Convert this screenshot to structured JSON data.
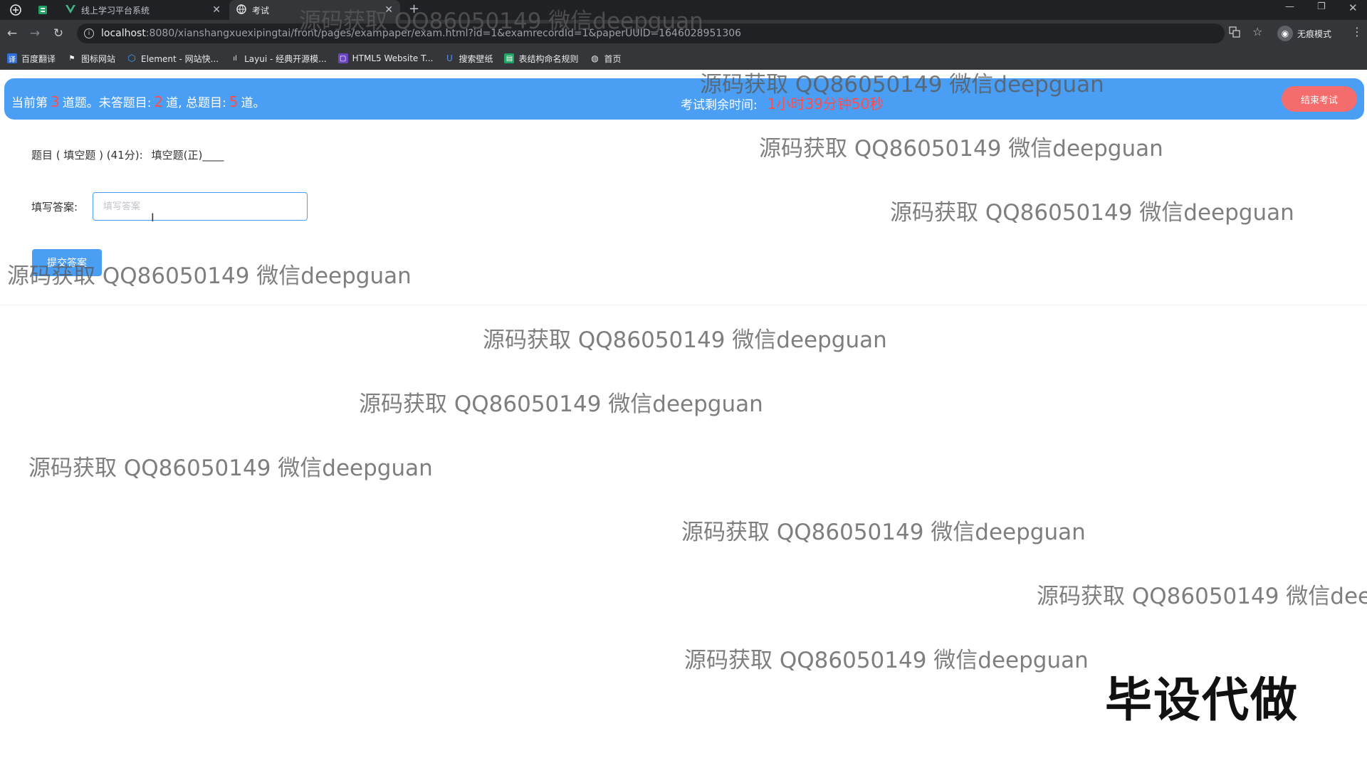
{
  "browser": {
    "tabs": [
      {
        "title": "线上学习平台系统"
      },
      {
        "title": "考试"
      }
    ],
    "url_host": "localhost",
    "url_path": ":8080/xianshangxuexipingtai/front/pages/exampaper/exam.html?id=1&examrecordId=1&paperUUID=1646028951306",
    "profile_label": "无痕模式",
    "bookmarks": [
      "百度翻译",
      "图标网站",
      "Element - 网站快...",
      "Layui - 经典开源模...",
      "HTML5 Website T...",
      "搜索壁纸",
      "表结构命名规则",
      "首页"
    ]
  },
  "exam": {
    "current_prefix": "当前第",
    "current_num": "3",
    "current_mid": "道题。未答题目:",
    "unanswered_num": "2",
    "unanswered_mid": "道, 总题目:",
    "total_num": "5",
    "total_suffix": "道。",
    "time_label": "考试剩余时间:",
    "time_value": "1小时39分钟50秒",
    "end_button": "结束考试",
    "question_label": "题目 ( 填空题 ) (41分):",
    "question_text": "填空题(正)____",
    "answer_label": "填写答案:",
    "answer_placeholder": "填写答案",
    "submit_button": "提交答案"
  },
  "watermark": {
    "text": "源码获取 QQ86050149 微信deepguan",
    "partial_text": "源码获取 QQ86050149 微信deep"
  },
  "stamp": "毕设代做"
}
